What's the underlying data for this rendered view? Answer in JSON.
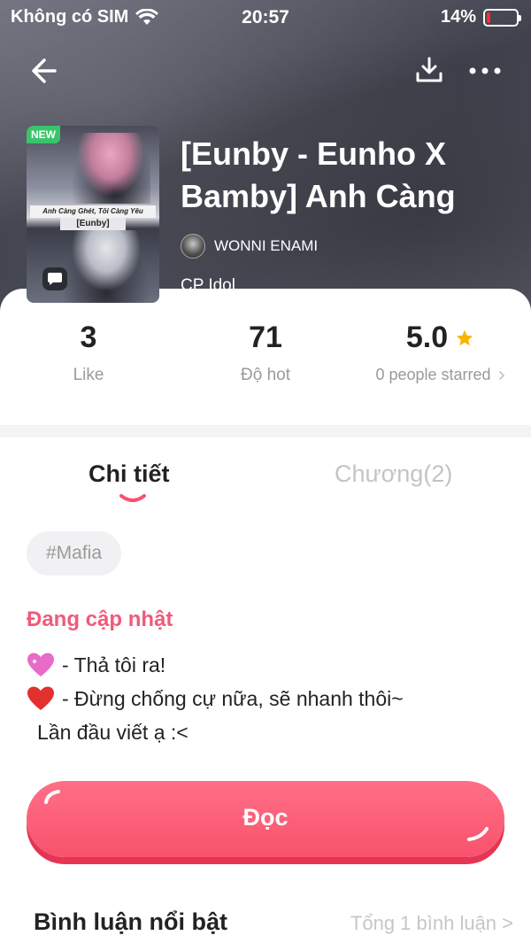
{
  "status_bar": {
    "carrier": "Không có SIM",
    "time": "20:57",
    "battery_percent": "14%",
    "battery_level": 0.14
  },
  "header": {
    "back_icon": "arrow-left-icon",
    "download_icon": "download-icon",
    "more_icon": "more-dots-icon"
  },
  "story": {
    "cover_badge": "NEW",
    "cover_banner": "Anh Càng Ghét, Tôi Càng Yêu",
    "cover_subtitle": "[Eunby]",
    "title": "[Eunby - Eunho X Bamby] Anh Càng",
    "author": "WONNI ENAMI",
    "category": "CP Idol"
  },
  "stats": {
    "likes_value": "3",
    "likes_label": "Like",
    "hot_value": "71",
    "hot_label": "Độ hot",
    "rating_value": "5.0",
    "rating_label": "0 people starred",
    "star_color": "#f7b500"
  },
  "tabs": {
    "details": "Chi tiết",
    "chapters": "Chương(2)"
  },
  "tag": "#Mafia",
  "status": "Đang cập nhật",
  "description": {
    "line1": "- Thả tôi ra!",
    "line2": "- Đừng chống cự nữa, sẽ nhanh thôi~",
    "line3": "Lần đầu viết ạ :<"
  },
  "read_button": "Đọc",
  "comments": {
    "title": "Bình luận nổi bật",
    "total": "Tổng 1 bình luận >"
  },
  "colors": {
    "accent": "#f9526d",
    "status_pink": "#f05a7a"
  }
}
